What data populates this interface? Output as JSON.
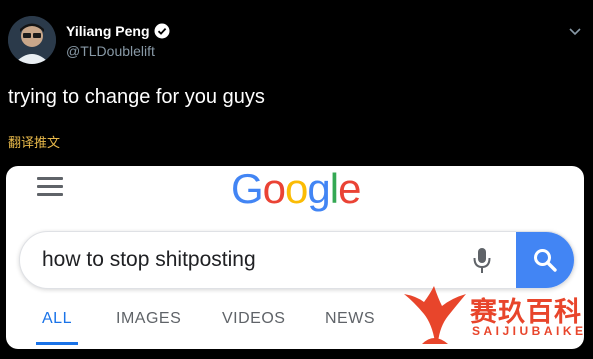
{
  "author": {
    "name": "Yiliang Peng",
    "handle": "@TLDoublelift",
    "verified": true
  },
  "tweet": {
    "text": "trying to change for you guys",
    "translate_label": "翻译推文"
  },
  "media": {
    "logo_text": [
      "G",
      "o",
      "o",
      "g",
      "l",
      "e"
    ],
    "logo_colors": [
      "#4285f4",
      "#ea4335",
      "#fbbc05",
      "#4285f4",
      "#34a853",
      "#ea4335"
    ],
    "search_value": "how to stop shitposting",
    "tabs": [
      "ALL",
      "IMAGES",
      "VIDEOS",
      "NEWS"
    ],
    "active_tab": "ALL"
  },
  "watermark": {
    "title": "赛玖百科",
    "subtitle": "SAIJIUBAIKE"
  },
  "colors": {
    "background": "#000000",
    "accent_blue": "#1a73e8",
    "translate_link": "#e8b94a",
    "watermark": "#e8452b"
  }
}
